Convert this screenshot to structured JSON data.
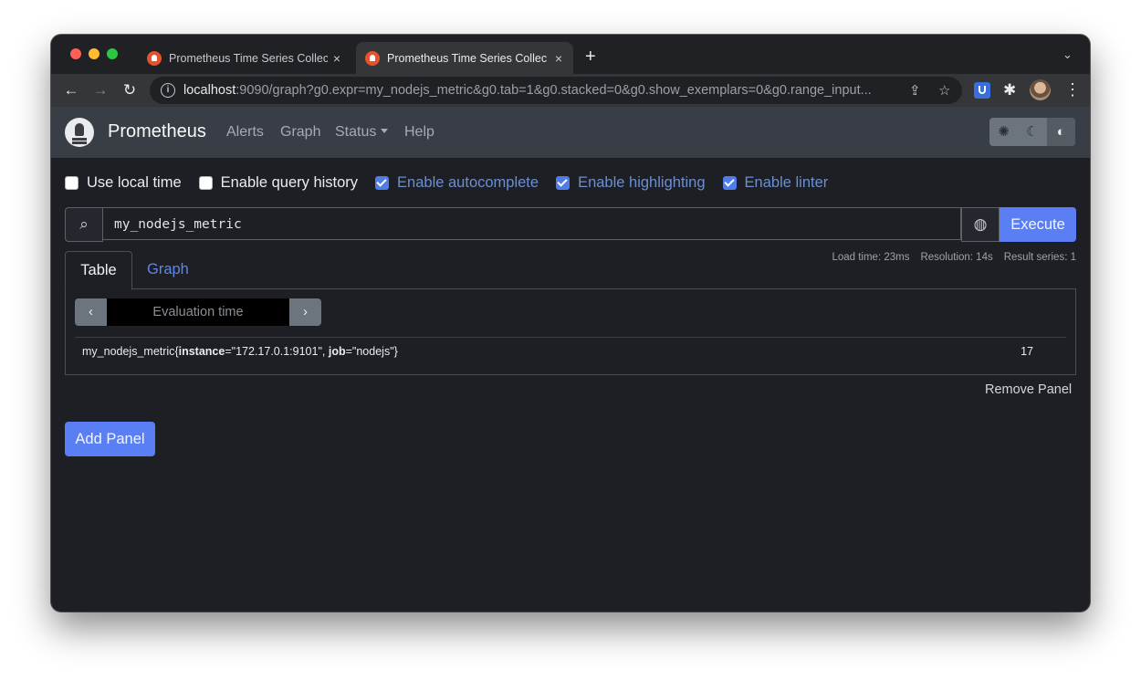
{
  "browser": {
    "tabs": [
      {
        "title": "Prometheus Time Series Collec",
        "close": "×"
      },
      {
        "title": "Prometheus Time Series Collec",
        "close": "×"
      }
    ],
    "new_tab": "+",
    "url_host": "localhost",
    "url_rest": ":9090/graph?g0.expr=my_nodejs_metric&g0.tab=1&g0.stacked=0&g0.show_exemplars=0&g0.range_input..."
  },
  "navbar": {
    "brand": "Prometheus",
    "links": [
      "Alerts",
      "Graph",
      "Status",
      "Help"
    ],
    "theme_buttons": [
      "light-theme-icon",
      "dark-theme-icon",
      "browser-default-theme-icon"
    ]
  },
  "options": [
    {
      "label": "Use local time",
      "checked": false
    },
    {
      "label": "Enable query history",
      "checked": false
    },
    {
      "label": "Enable autocomplete",
      "checked": true
    },
    {
      "label": "Enable highlighting",
      "checked": true
    },
    {
      "label": "Enable linter",
      "checked": true
    }
  ],
  "query": {
    "expression": "my_nodejs_metric",
    "execute_label": "Execute"
  },
  "stats": {
    "load_time": "Load time: 23ms",
    "resolution": "Resolution: 14s",
    "result_series": "Result series: 1"
  },
  "panel_tabs": [
    "Table",
    "Graph"
  ],
  "eval": {
    "placeholder": "Evaluation time",
    "prev": "‹",
    "next": "›"
  },
  "result": {
    "metric_name": "my_nodejs_metric",
    "labels": [
      {
        "key": "instance",
        "value": "\"172.17.0.1:9101\""
      },
      {
        "key": "job",
        "value": "\"nodejs\""
      }
    ],
    "value": "17"
  },
  "remove_panel": "Remove Panel",
  "add_panel": "Add Panel",
  "colors": {
    "accent": "#5a7ff4",
    "navbar": "#393d45",
    "background": "#1d1f25"
  }
}
